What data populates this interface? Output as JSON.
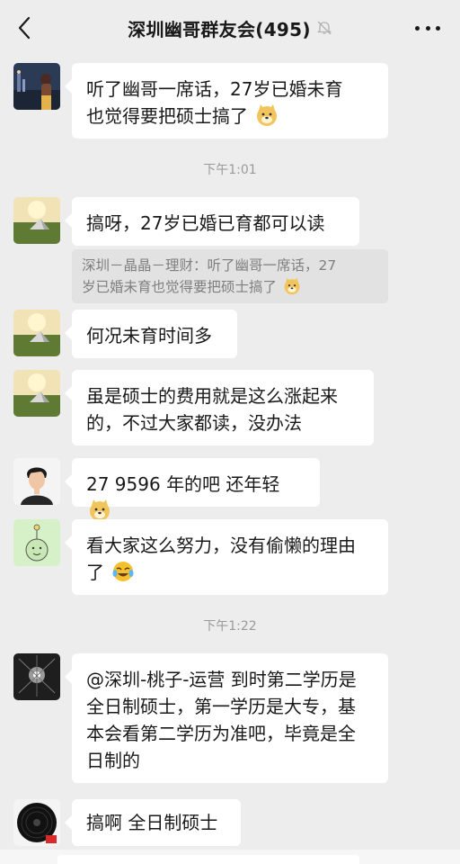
{
  "header": {
    "title": "深圳幽哥群友会(495)",
    "back_icon": "chevron-left-icon",
    "mute_icon": "bell-off-icon",
    "more_icon": "ellipsis-icon"
  },
  "messages": [
    {
      "avatar": "avatar-city-night",
      "text": "听了幽哥一席话，27岁已婚未育\n也觉得要把硕士搞了",
      "emoji": "doge-emoji"
    },
    {
      "time": "下午1:01"
    },
    {
      "avatar": "avatar-tent-landscape",
      "text": "搞呀，27岁已婚已育都可以读",
      "quote": "深圳－晶晶－理财：听了幽哥一席话，27\n岁已婚未育也觉得要把硕士搞了",
      "quote_emoji": "doge-emoji"
    },
    {
      "avatar": "avatar-tent-landscape",
      "text": "何况未育时间多"
    },
    {
      "avatar": "avatar-tent-landscape",
      "text": "虽是硕士的费用就是这么涨起来\n的，不过大家都读，没办法"
    },
    {
      "avatar": "avatar-young-man",
      "text": "27 9596 年的吧 还年轻",
      "emoji": "doge-emoji"
    },
    {
      "avatar": "avatar-flower-doodle",
      "text": "看大家这么努力，没有偷懒的理由\n了",
      "emoji": "crying-laugh-emoji"
    },
    {
      "time": "下午1:22"
    },
    {
      "avatar": "avatar-light-burst",
      "text": "@深圳-桃子-运营  到时第二学历是\n全日制硕士，第一学历是大专，基\n本会看第二学历为准吧，毕竟是全\n日制的"
    },
    {
      "avatar": "avatar-vinyl-record",
      "text": "搞啊 全日制硕士"
    }
  ]
}
